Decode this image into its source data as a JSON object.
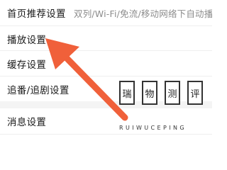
{
  "settings": {
    "rows": [
      {
        "label": "首页推荐设置",
        "description": "双列/Wi-Fi/免流/移动网络下自动播放"
      },
      {
        "label": "播放设置"
      },
      {
        "label": "缓存设置"
      },
      {
        "label": "追番/追剧设置"
      },
      {
        "label": "消息设置"
      }
    ]
  },
  "watermark": {
    "glyphs": [
      "瑞",
      "物",
      "测",
      "评"
    ],
    "latin": "RUIWUCEPING"
  },
  "colors": {
    "arrow": "#f0603a",
    "text": "#1a1a1a",
    "secondary": "#8c8c8c",
    "divider": "#eeeeee",
    "section_gap": "#f4f4f4"
  }
}
